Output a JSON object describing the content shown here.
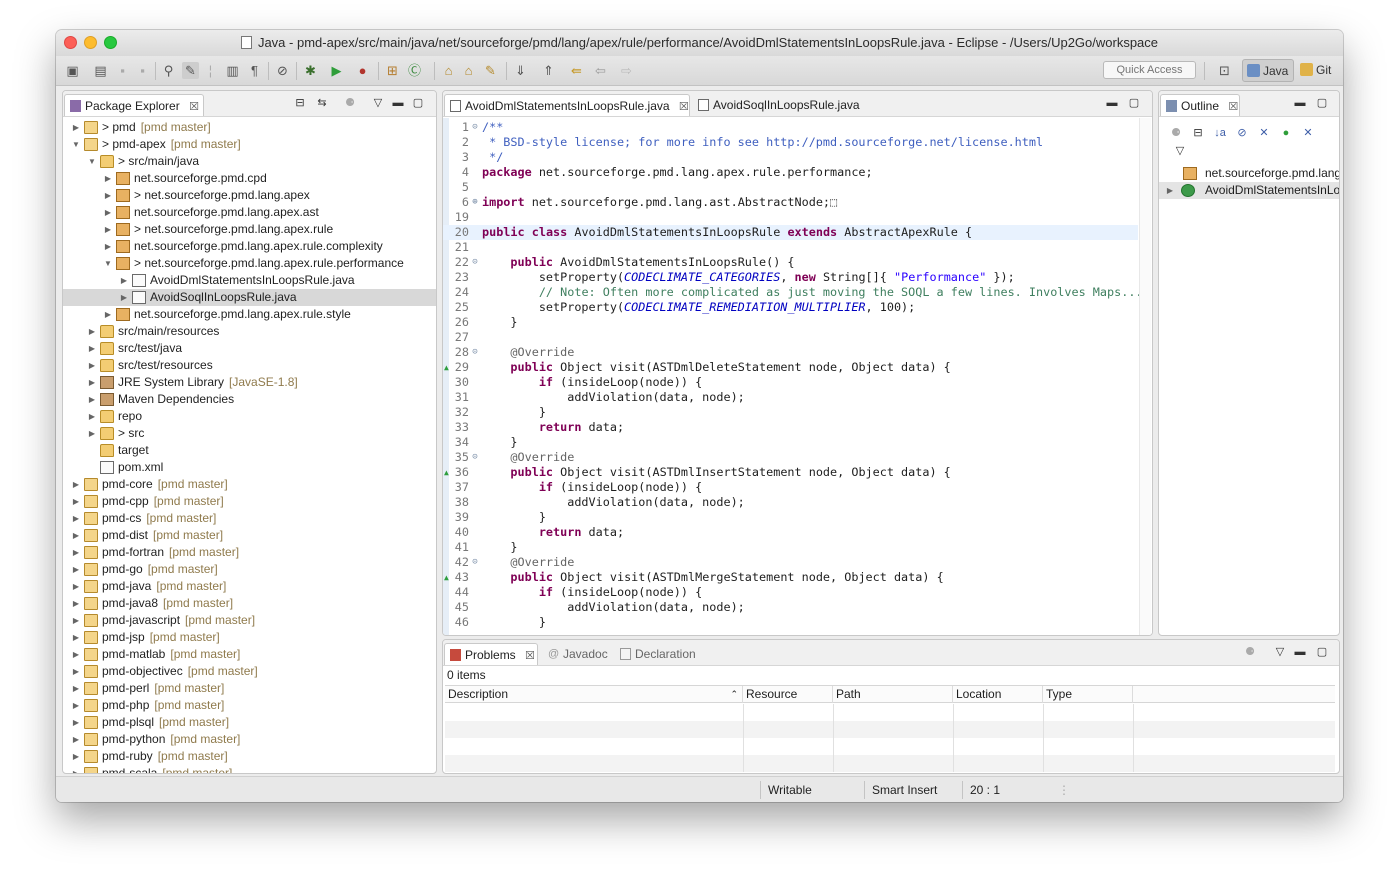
{
  "window": {
    "title": "Java - pmd-apex/src/main/java/net/sourceforge/pmd/lang/apex/rule/performance/AvoidDmlStatementsInLoopsRule.java - Eclipse - /Users/Up2Go/workspace"
  },
  "toolbar": {
    "quick_access_placeholder": "Quick Access",
    "perspectives": [
      {
        "label": "Java",
        "icon": "java-perspective-icon",
        "active": true
      },
      {
        "label": "Git",
        "icon": "git-perspective-icon",
        "active": false
      }
    ]
  },
  "package_explorer": {
    "title": "Package Explorer",
    "tree": [
      {
        "label": "> pmd",
        "suffix": "[pmd master]",
        "level": 0,
        "icon": "project-icon",
        "expanded": false
      },
      {
        "label": "> pmd-apex",
        "suffix": "[pmd master]",
        "level": 0,
        "icon": "project-icon",
        "expanded": true
      },
      {
        "label": "> src/main/java",
        "suffix": "",
        "level": 1,
        "icon": "source-folder-icon",
        "expanded": true
      },
      {
        "label": "net.sourceforge.pmd.cpd",
        "suffix": "",
        "level": 2,
        "icon": "package-icon",
        "expanded": false
      },
      {
        "label": "> net.sourceforge.pmd.lang.apex",
        "suffix": "",
        "level": 2,
        "icon": "package-icon",
        "expanded": false
      },
      {
        "label": "net.sourceforge.pmd.lang.apex.ast",
        "suffix": "",
        "level": 2,
        "icon": "package-icon",
        "expanded": false
      },
      {
        "label": "> net.sourceforge.pmd.lang.apex.rule",
        "suffix": "",
        "level": 2,
        "icon": "package-icon",
        "expanded": false
      },
      {
        "label": "net.sourceforge.pmd.lang.apex.rule.complexity",
        "suffix": "",
        "level": 2,
        "icon": "package-icon",
        "expanded": false
      },
      {
        "label": "> net.sourceforge.pmd.lang.apex.rule.performance",
        "suffix": "",
        "level": 2,
        "icon": "package-icon",
        "expanded": true
      },
      {
        "label": "AvoidDmlStatementsInLoopsRule.java",
        "suffix": "",
        "level": 3,
        "icon": "java-file-icon",
        "expanded": false
      },
      {
        "label": "AvoidSoqlInLoopsRule.java",
        "suffix": "",
        "level": 3,
        "icon": "java-file-icon",
        "expanded": false,
        "selected": true
      },
      {
        "label": "net.sourceforge.pmd.lang.apex.rule.style",
        "suffix": "",
        "level": 2,
        "icon": "package-icon",
        "expanded": false
      },
      {
        "label": "src/main/resources",
        "suffix": "",
        "level": 1,
        "icon": "source-folder-icon",
        "expanded": false
      },
      {
        "label": "src/test/java",
        "suffix": "",
        "level": 1,
        "icon": "source-folder-icon",
        "expanded": false
      },
      {
        "label": "src/test/resources",
        "suffix": "",
        "level": 1,
        "icon": "source-folder-icon",
        "expanded": false
      },
      {
        "label": "JRE System Library",
        "suffix": "[JavaSE-1.8]",
        "level": 1,
        "icon": "library-icon",
        "expanded": false
      },
      {
        "label": "Maven Dependencies",
        "suffix": "",
        "level": 1,
        "icon": "library-icon",
        "expanded": false
      },
      {
        "label": "repo",
        "suffix": "",
        "level": 1,
        "icon": "folder-icon",
        "expanded": false
      },
      {
        "label": "> src",
        "suffix": "",
        "level": 1,
        "icon": "folder-icon",
        "expanded": false
      },
      {
        "label": "target",
        "suffix": "",
        "level": 1,
        "icon": "folder-icon",
        "leaf": true
      },
      {
        "label": "pom.xml",
        "suffix": "",
        "level": 1,
        "icon": "xml-file-icon",
        "leaf": true
      },
      {
        "label": "pmd-core",
        "suffix": "[pmd master]",
        "level": 0,
        "icon": "project-icon",
        "expanded": false
      },
      {
        "label": "pmd-cpp",
        "suffix": "[pmd master]",
        "level": 0,
        "icon": "project-icon",
        "expanded": false
      },
      {
        "label": "pmd-cs",
        "suffix": "[pmd master]",
        "level": 0,
        "icon": "project-icon",
        "expanded": false
      },
      {
        "label": "pmd-dist",
        "suffix": "[pmd master]",
        "level": 0,
        "icon": "project-icon",
        "expanded": false
      },
      {
        "label": "pmd-fortran",
        "suffix": "[pmd master]",
        "level": 0,
        "icon": "project-icon",
        "expanded": false
      },
      {
        "label": "pmd-go",
        "suffix": "[pmd master]",
        "level": 0,
        "icon": "project-icon",
        "expanded": false
      },
      {
        "label": "pmd-java",
        "suffix": "[pmd master]",
        "level": 0,
        "icon": "project-icon",
        "expanded": false
      },
      {
        "label": "pmd-java8",
        "suffix": "[pmd master]",
        "level": 0,
        "icon": "project-icon",
        "expanded": false
      },
      {
        "label": "pmd-javascript",
        "suffix": "[pmd master]",
        "level": 0,
        "icon": "project-icon",
        "expanded": false
      },
      {
        "label": "pmd-jsp",
        "suffix": "[pmd master]",
        "level": 0,
        "icon": "project-icon",
        "expanded": false
      },
      {
        "label": "pmd-matlab",
        "suffix": "[pmd master]",
        "level": 0,
        "icon": "project-icon",
        "expanded": false
      },
      {
        "label": "pmd-objectivec",
        "suffix": "[pmd master]",
        "level": 0,
        "icon": "project-icon",
        "expanded": false
      },
      {
        "label": "pmd-perl",
        "suffix": "[pmd master]",
        "level": 0,
        "icon": "project-icon",
        "expanded": false
      },
      {
        "label": "pmd-php",
        "suffix": "[pmd master]",
        "level": 0,
        "icon": "project-icon",
        "expanded": false
      },
      {
        "label": "pmd-plsql",
        "suffix": "[pmd master]",
        "level": 0,
        "icon": "project-icon",
        "expanded": false
      },
      {
        "label": "pmd-python",
        "suffix": "[pmd master]",
        "level": 0,
        "icon": "project-icon",
        "expanded": false
      },
      {
        "label": "pmd-ruby",
        "suffix": "[pmd master]",
        "level": 0,
        "icon": "project-icon",
        "expanded": false
      },
      {
        "label": "pmd-scala",
        "suffix": "[pmd master]",
        "level": 0,
        "icon": "project-icon",
        "expanded": false
      }
    ]
  },
  "editor": {
    "tabs": [
      {
        "label": "AvoidDmlStatementsInLoopsRule.java",
        "active": true
      },
      {
        "label": "AvoidSoqlInLoopsRule.java",
        "active": false
      }
    ],
    "current_line": 20,
    "lines": [
      {
        "n": "1",
        "fold": "⊝",
        "segs": [
          {
            "t": "/**",
            "c": "jd"
          }
        ]
      },
      {
        "n": "2",
        "segs": [
          {
            "t": " * BSD-style license; for more info see http://pmd.sourceforge.net/license.html",
            "c": "jd"
          }
        ]
      },
      {
        "n": "3",
        "segs": [
          {
            "t": " */",
            "c": "jd"
          }
        ]
      },
      {
        "n": "4",
        "segs": [
          {
            "t": "package",
            "c": "kw"
          },
          {
            "t": " net.sourceforge.pmd.lang.apex.rule.performance;",
            "c": ""
          }
        ]
      },
      {
        "n": "5",
        "segs": []
      },
      {
        "n": "6",
        "fold": "⊕",
        "segs": [
          {
            "t": "import",
            "c": "kw"
          },
          {
            "t": " net.sourceforge.pmd.lang.ast.AbstractNode;⬚",
            "c": ""
          }
        ]
      },
      {
        "n": "19",
        "segs": []
      },
      {
        "n": "20",
        "segs": [
          {
            "t": "public",
            "c": "kw"
          },
          {
            "t": " ",
            "c": ""
          },
          {
            "t": "class",
            "c": "kw"
          },
          {
            "t": " AvoidDmlStatementsInLoopsRule ",
            "c": ""
          },
          {
            "t": "extends",
            "c": "kw"
          },
          {
            "t": " AbstractApexRule {",
            "c": ""
          }
        ]
      },
      {
        "n": "21",
        "segs": []
      },
      {
        "n": "22",
        "fold": "⊝",
        "segs": [
          {
            "t": "    ",
            "c": ""
          },
          {
            "t": "public",
            "c": "kw"
          },
          {
            "t": " AvoidDmlStatementsInLoopsRule() {",
            "c": ""
          }
        ]
      },
      {
        "n": "23",
        "segs": [
          {
            "t": "        setProperty(",
            "c": ""
          },
          {
            "t": "CODECLIMATE_CATEGORIES",
            "c": "ci"
          },
          {
            "t": ", ",
            "c": ""
          },
          {
            "t": "new",
            "c": "kw"
          },
          {
            "t": " String[]{ ",
            "c": ""
          },
          {
            "t": "\"Performance\"",
            "c": "st"
          },
          {
            "t": " });",
            "c": ""
          }
        ]
      },
      {
        "n": "24",
        "segs": [
          {
            "t": "        ",
            "c": ""
          },
          {
            "t": "// Note: Often more complicated as just moving the SOQL a few lines. Involves Maps...",
            "c": "cm"
          }
        ]
      },
      {
        "n": "25",
        "segs": [
          {
            "t": "        setProperty(",
            "c": ""
          },
          {
            "t": "CODECLIMATE_REMEDIATION_MULTIPLIER",
            "c": "ci"
          },
          {
            "t": ", 100);",
            "c": ""
          }
        ]
      },
      {
        "n": "26",
        "segs": [
          {
            "t": "    }",
            "c": ""
          }
        ]
      },
      {
        "n": "27",
        "segs": []
      },
      {
        "n": "28",
        "fold": "⊝",
        "segs": [
          {
            "t": "    ",
            "c": ""
          },
          {
            "t": "@Override",
            "c": "an"
          }
        ]
      },
      {
        "n": "29",
        "override": true,
        "segs": [
          {
            "t": "    ",
            "c": ""
          },
          {
            "t": "public",
            "c": "kw"
          },
          {
            "t": " Object visit(ASTDmlDeleteStatement node, Object data) {",
            "c": ""
          }
        ]
      },
      {
        "n": "30",
        "segs": [
          {
            "t": "        ",
            "c": ""
          },
          {
            "t": "if",
            "c": "kw"
          },
          {
            "t": " (insideLoop(node)) {",
            "c": ""
          }
        ]
      },
      {
        "n": "31",
        "segs": [
          {
            "t": "            addViolation(data, node);",
            "c": ""
          }
        ]
      },
      {
        "n": "32",
        "segs": [
          {
            "t": "        }",
            "c": ""
          }
        ]
      },
      {
        "n": "33",
        "segs": [
          {
            "t": "        ",
            "c": ""
          },
          {
            "t": "return",
            "c": "kw"
          },
          {
            "t": " data;",
            "c": ""
          }
        ]
      },
      {
        "n": "34",
        "segs": [
          {
            "t": "    }",
            "c": ""
          }
        ]
      },
      {
        "n": "35",
        "fold": "⊝",
        "segs": [
          {
            "t": "    ",
            "c": ""
          },
          {
            "t": "@Override",
            "c": "an"
          }
        ]
      },
      {
        "n": "36",
        "override": true,
        "segs": [
          {
            "t": "    ",
            "c": ""
          },
          {
            "t": "public",
            "c": "kw"
          },
          {
            "t": " Object visit(ASTDmlInsertStatement node, Object data) {",
            "c": ""
          }
        ]
      },
      {
        "n": "37",
        "segs": [
          {
            "t": "        ",
            "c": ""
          },
          {
            "t": "if",
            "c": "kw"
          },
          {
            "t": " (insideLoop(node)) {",
            "c": ""
          }
        ]
      },
      {
        "n": "38",
        "segs": [
          {
            "t": "            addViolation(data, node);",
            "c": ""
          }
        ]
      },
      {
        "n": "39",
        "segs": [
          {
            "t": "        }",
            "c": ""
          }
        ]
      },
      {
        "n": "40",
        "segs": [
          {
            "t": "        ",
            "c": ""
          },
          {
            "t": "return",
            "c": "kw"
          },
          {
            "t": " data;",
            "c": ""
          }
        ]
      },
      {
        "n": "41",
        "segs": [
          {
            "t": "    }",
            "c": ""
          }
        ]
      },
      {
        "n": "42",
        "fold": "⊝",
        "segs": [
          {
            "t": "    ",
            "c": ""
          },
          {
            "t": "@Override",
            "c": "an"
          }
        ]
      },
      {
        "n": "43",
        "override": true,
        "segs": [
          {
            "t": "    ",
            "c": ""
          },
          {
            "t": "public",
            "c": "kw"
          },
          {
            "t": " Object visit(ASTDmlMergeStatement node, Object data) {",
            "c": ""
          }
        ]
      },
      {
        "n": "44",
        "segs": [
          {
            "t": "        ",
            "c": ""
          },
          {
            "t": "if",
            "c": "kw"
          },
          {
            "t": " (insideLoop(node)) {",
            "c": ""
          }
        ]
      },
      {
        "n": "45",
        "segs": [
          {
            "t": "            addViolation(data, node);",
            "c": ""
          }
        ]
      },
      {
        "n": "46",
        "segs": [
          {
            "t": "        }",
            "c": ""
          }
        ]
      }
    ]
  },
  "outline": {
    "title": "Outline",
    "items": [
      {
        "label": "net.sourceforge.pmd.lang.apex.rule.performance",
        "icon": "package-icon"
      },
      {
        "label": "AvoidDmlStatementsInLoopsRule",
        "icon": "class-icon"
      }
    ]
  },
  "problems": {
    "tabs": [
      {
        "label": "Problems",
        "active": true
      },
      {
        "label": "Javadoc",
        "active": false
      },
      {
        "label": "Declaration",
        "active": false
      }
    ],
    "count_text": "0 items",
    "columns": [
      "Description",
      "Resource",
      "Path",
      "Location",
      "Type"
    ]
  },
  "status": {
    "writable": "Writable",
    "insert_mode": "Smart Insert",
    "position": "20 : 1"
  },
  "colors": {
    "keyword": "#7f0055",
    "comment": "#3f7f5f",
    "javadoc": "#3f5fbf",
    "string": "#2a00ff",
    "constant": "#0000c0",
    "current_line": "#e8f2fe",
    "selection": "#d8d8d8"
  }
}
